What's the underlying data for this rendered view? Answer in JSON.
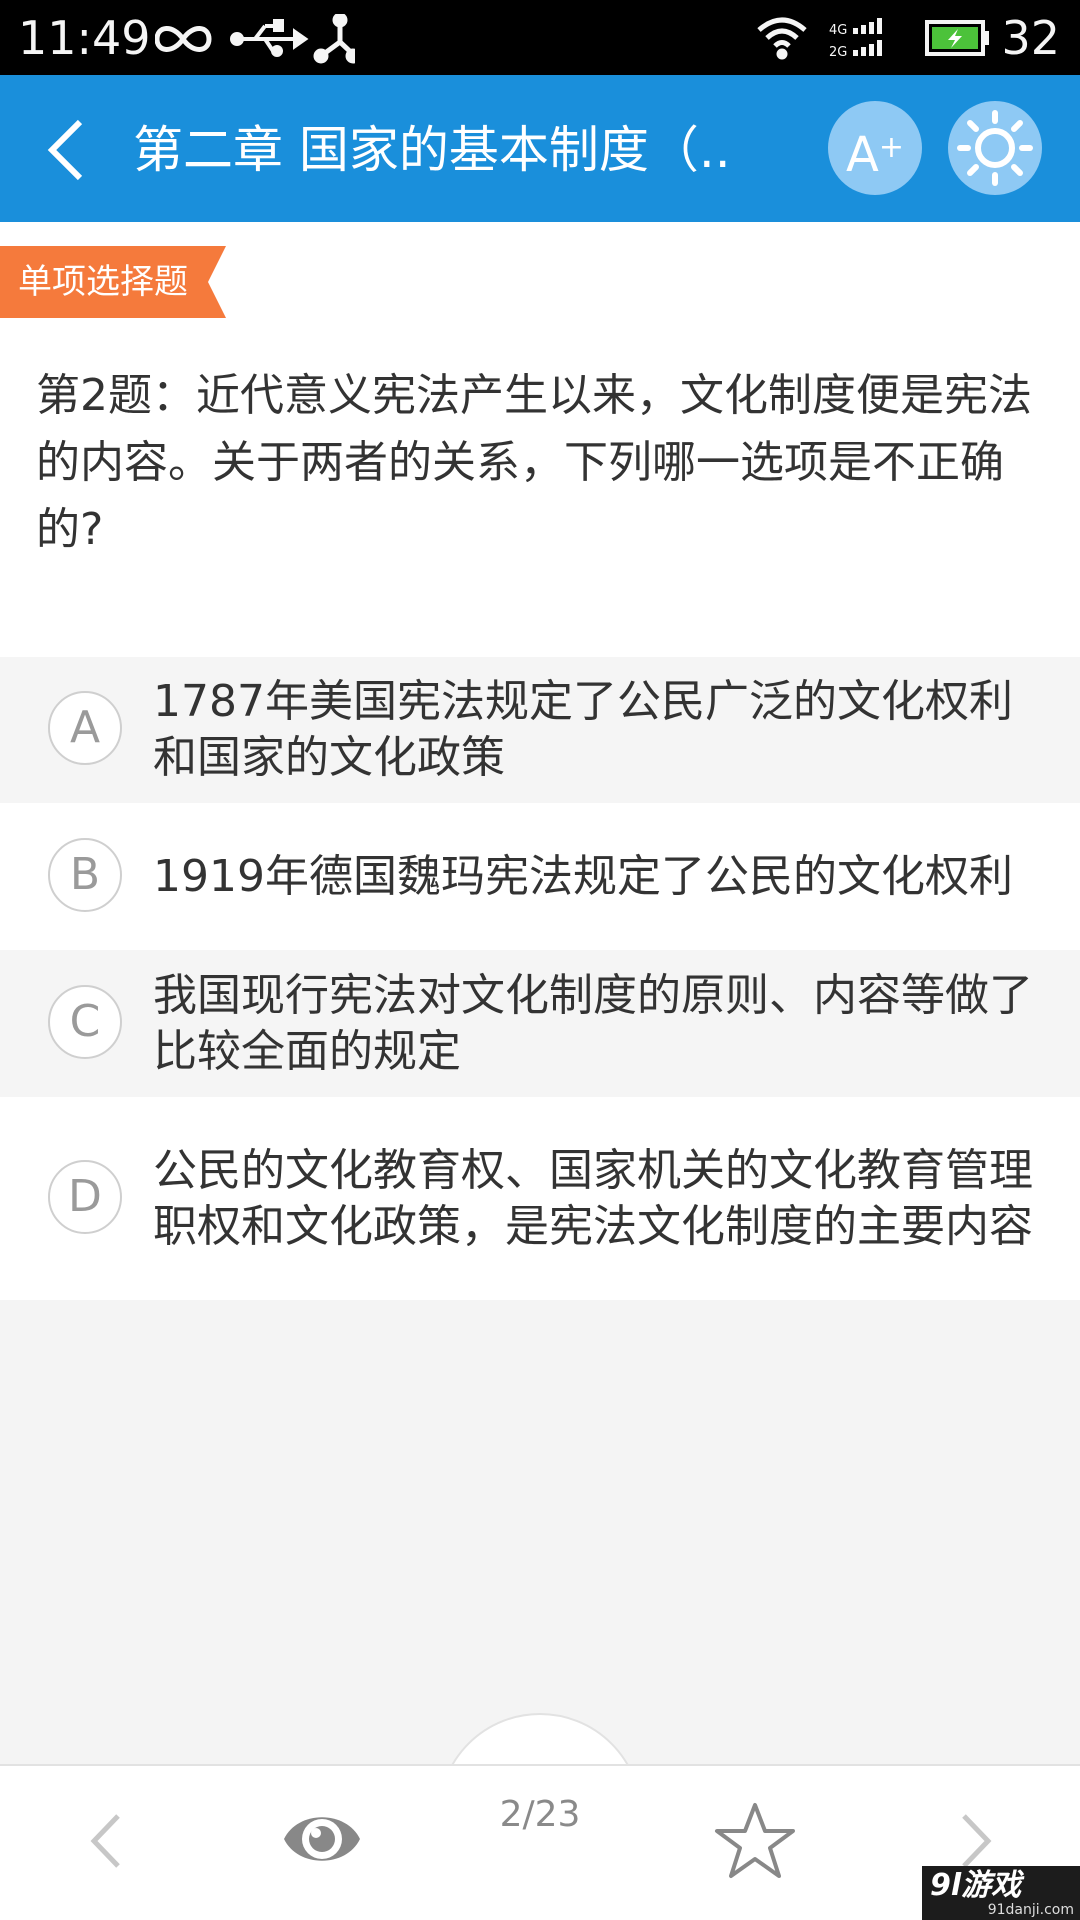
{
  "status_bar": {
    "time": "11:49",
    "battery_percent": "32",
    "network_4g": "4G",
    "network_2g": "2G"
  },
  "header": {
    "title": "第二章 国家的基本制度（..",
    "font_size_label": "A",
    "font_size_plus": "+",
    "background_color": "#1a8fdb"
  },
  "question": {
    "type_label": "单项选择题",
    "text": "第2题：近代意义宪法产生以来，文化制度便是宪法的内容。关于两者的关系，下列哪一选项是不正确的?",
    "tag_color": "#f57a3c"
  },
  "options": [
    {
      "letter": "A",
      "text": "1787年美国宪法规定了公民广泛的文化权利和国家的文化政策"
    },
    {
      "letter": "B",
      "text": "1919年德国魏玛宪法规定了公民的文化权利"
    },
    {
      "letter": "C",
      "text": "我国现行宪法对文化制度的原则、内容等做了比较全面的规定"
    },
    {
      "letter": "D",
      "text": "公民的文化教育权、国家机关的文化教育管理职权和文化政策，是宪法文化制度的主要内容"
    }
  ],
  "bottom_nav": {
    "page_counter": "2/23",
    "icons": [
      "chevron-left-icon",
      "eye-icon",
      "star-icon",
      "chevron-right-icon"
    ]
  },
  "watermark": {
    "logo_text": "9l游戏",
    "site_text": "91danji.com"
  }
}
